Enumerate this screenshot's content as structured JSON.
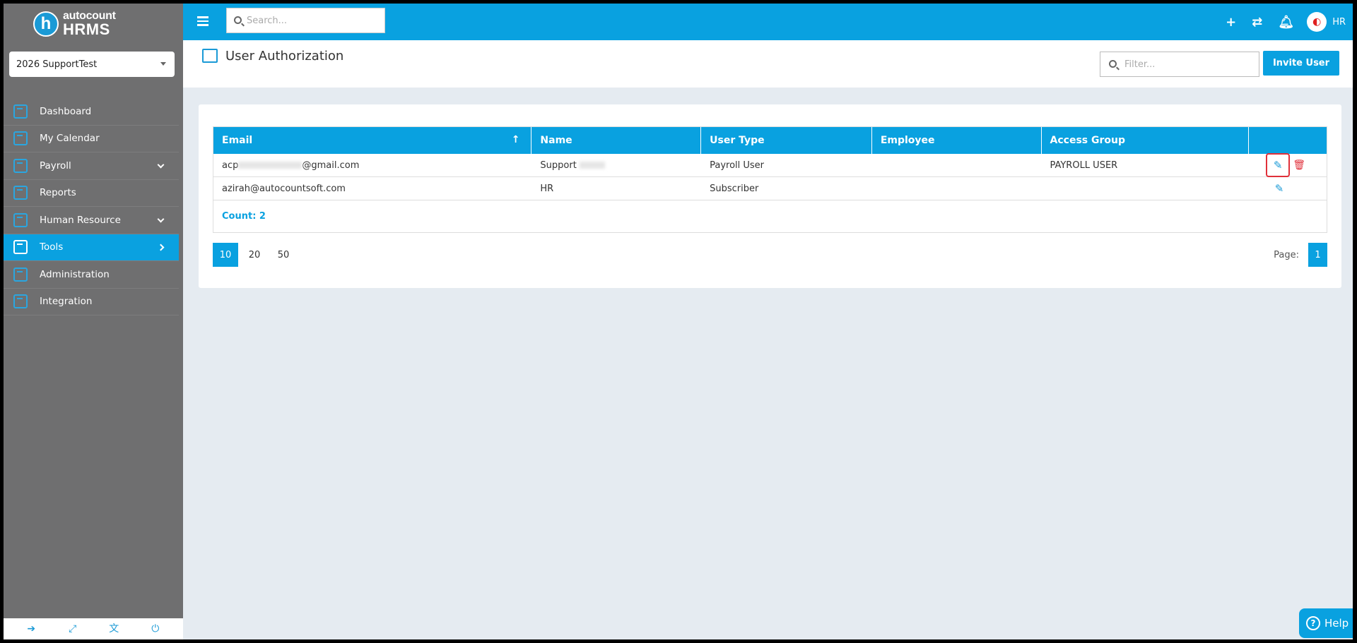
{
  "brand": {
    "mark": "h",
    "line1": "autocount",
    "line2": "HRMS"
  },
  "company": {
    "selected": "2026 SupportTest"
  },
  "sidebar": {
    "items": [
      {
        "label": "Dashboard"
      },
      {
        "label": "My Calendar"
      },
      {
        "label": "Payroll"
      },
      {
        "label": "Reports"
      },
      {
        "label": "Human Resource"
      },
      {
        "label": "Tools"
      },
      {
        "label": "Administration"
      },
      {
        "label": "Integration"
      }
    ]
  },
  "topbar": {
    "search_placeholder": "Search...",
    "user": "HR"
  },
  "page": {
    "title": "User Authorization",
    "filter_placeholder": "Filter...",
    "invite_label": "Invite User"
  },
  "table": {
    "headers": [
      "Email",
      "Name",
      "User Type",
      "Employee",
      "Access Group"
    ],
    "rows": [
      {
        "email_prefix": "acp",
        "email_suffix": "@gmail.com",
        "name": "Support",
        "user_type": "Payroll User",
        "employee": "",
        "access_group": "PAYROLL USER"
      },
      {
        "email": "azirah@autocountsoft.com",
        "name": "HR",
        "user_type": "Subscriber",
        "employee": "",
        "access_group": ""
      }
    ],
    "count_label": "Count: 2"
  },
  "pager": {
    "sizes": [
      "10",
      "20",
      "50"
    ],
    "page_label": "Page:",
    "current_page": "1"
  },
  "help": {
    "label": "Help"
  }
}
